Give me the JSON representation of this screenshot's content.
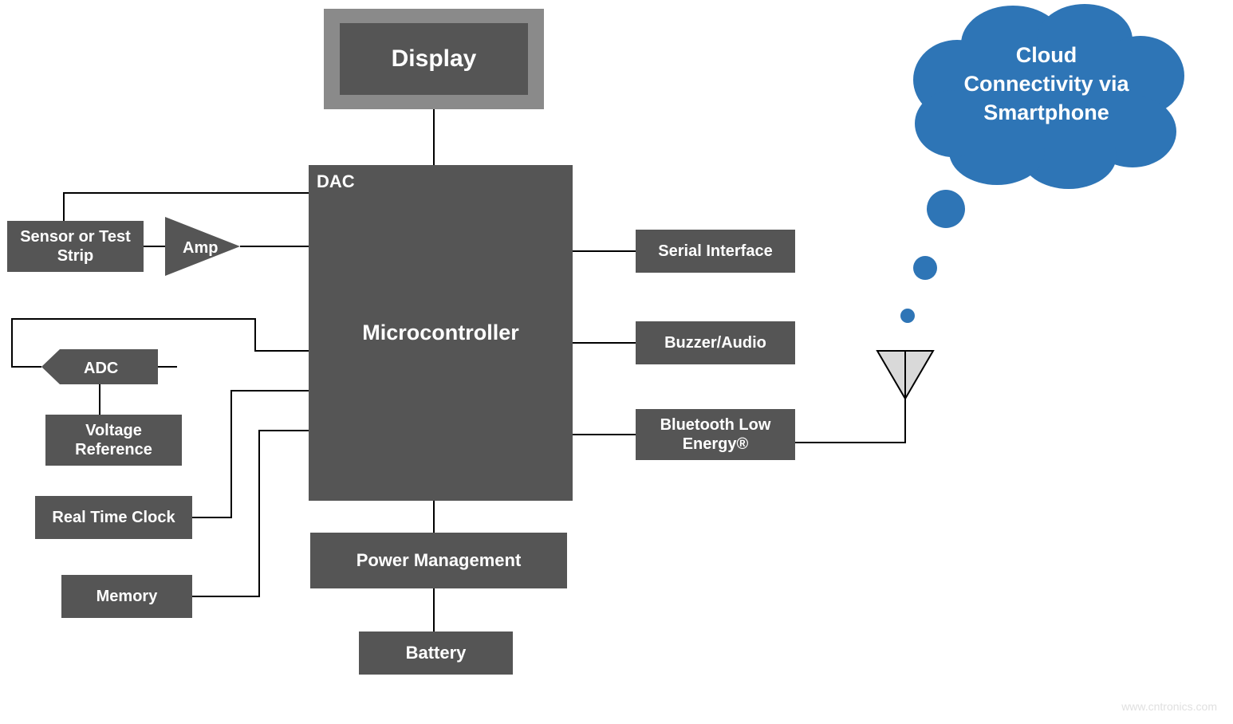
{
  "blocks": {
    "display": "Display",
    "dac": "DAC",
    "microcontroller": "Microcontroller",
    "sensor": "Sensor or Test Strip",
    "amp": "Amp",
    "adc": "ADC",
    "voltage_ref": "Voltage Reference",
    "rtc": "Real Time Clock",
    "memory": "Memory",
    "serial": "Serial Interface",
    "buzzer": "Buzzer/Audio",
    "ble": "Bluetooth Low Energy®",
    "power": "Power Management",
    "battery": "Battery",
    "cloud": "Cloud Connectivity via Smartphone"
  },
  "watermark": "www.cntronics.com",
  "colors": {
    "block": "#555555",
    "display_border": "#8A8A8A",
    "cloud": "#2E75B6",
    "antenna_fill": "#D9D9D9",
    "line": "#000000"
  }
}
